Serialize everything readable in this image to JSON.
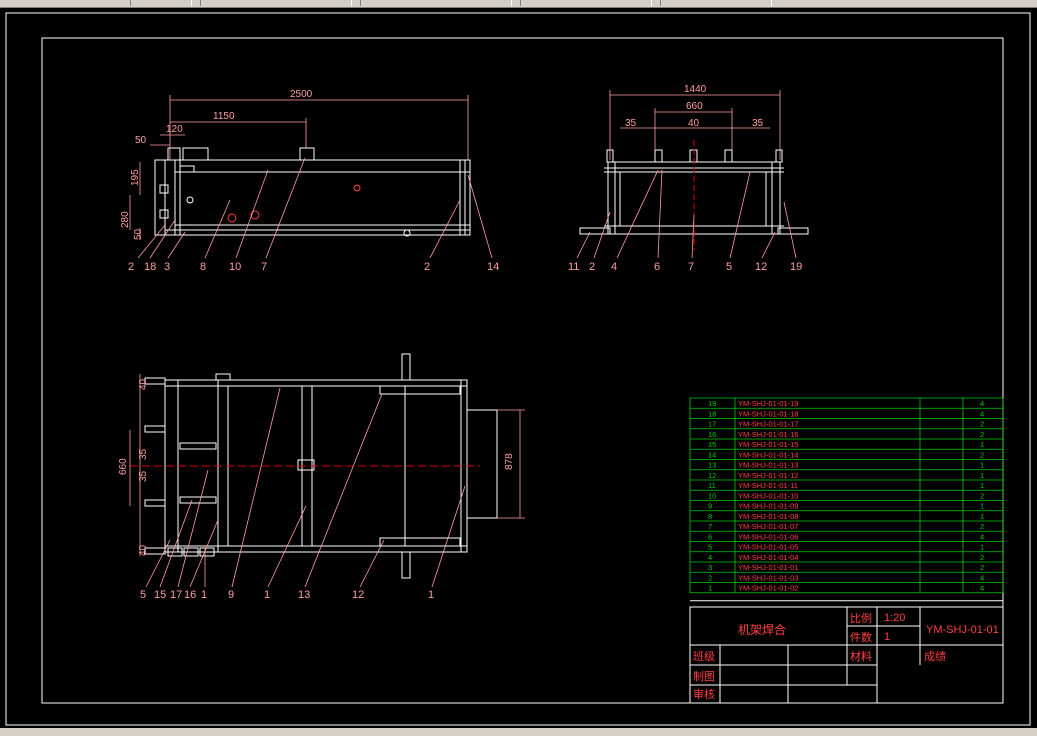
{
  "colors": {
    "background": "#000000",
    "geometry": "#ffffff",
    "dimension": "#ff9f9f",
    "table_grid": "#00cc00",
    "table_text": "#ff4040",
    "centerline": "#e00000"
  },
  "front_view": {
    "dims": [
      "2500",
      "1150",
      "120",
      "50",
      "195",
      "280",
      "50"
    ],
    "callouts": [
      "2",
      "18",
      "3",
      "8",
      "10",
      "7",
      "2",
      "14"
    ]
  },
  "side_view": {
    "dims": [
      "1440",
      "660",
      "35",
      "40",
      "35"
    ],
    "callouts": [
      "11",
      "2",
      "4",
      "6",
      "7",
      "5",
      "12",
      "19"
    ]
  },
  "top_view": {
    "dims": [
      "40",
      "35",
      "660",
      "35",
      "40",
      "878"
    ],
    "callouts": [
      "5",
      "15",
      "17",
      "16",
      "1",
      "9",
      "1",
      "13",
      "12",
      "1"
    ]
  },
  "parts_table": {
    "rows": [
      {
        "no": "19",
        "code": "YM-SHJ-01-01-19",
        "qty": "4"
      },
      {
        "no": "18",
        "code": "YM-SHJ-01-01-18",
        "qty": "4"
      },
      {
        "no": "17",
        "code": "YM-SHJ-01-01-17",
        "qty": "2"
      },
      {
        "no": "16",
        "code": "YM-SHJ-01-01-16",
        "qty": "2"
      },
      {
        "no": "15",
        "code": "YM-SHJ-01-01-15",
        "qty": "1"
      },
      {
        "no": "14",
        "code": "YM-SHJ-01-01-14",
        "qty": "2"
      },
      {
        "no": "13",
        "code": "YM-SHJ-01-01-13",
        "qty": "1"
      },
      {
        "no": "12",
        "code": "YM-SHJ-01-01-12",
        "qty": "1"
      },
      {
        "no": "11",
        "code": "YM-SHJ-01-01-11",
        "qty": "1"
      },
      {
        "no": "10",
        "code": "YM-SHJ-01-01-10",
        "qty": "2"
      },
      {
        "no": "9",
        "code": "YM-SHJ-01-01-09",
        "qty": "1"
      },
      {
        "no": "8",
        "code": "YM-SHJ-01-01-08",
        "qty": "1"
      },
      {
        "no": "7",
        "code": "YM-SHJ-01-01-07",
        "qty": "2"
      },
      {
        "no": "6",
        "code": "YM-SHJ-01-01-06",
        "qty": "4"
      },
      {
        "no": "5",
        "code": "YM-SHJ-01-01-05",
        "qty": "1"
      },
      {
        "no": "4",
        "code": "YM-SHJ-01-01-04",
        "qty": "2"
      },
      {
        "no": "3",
        "code": "YM-SHJ-01-01-01",
        "qty": "2"
      },
      {
        "no": "2",
        "code": "YM-SHJ-01-01-03",
        "qty": "4"
      },
      {
        "no": "1",
        "code": "YM-SHJ-01-01-02",
        "qty": "4"
      }
    ]
  },
  "title_block": {
    "drawing_title": "机架焊合",
    "scale_label": "比例",
    "scale_value": "1:20",
    "count_label": "件数",
    "count_value": "1",
    "drawing_no": "YM-SHJ-01-01",
    "class_label": "班级",
    "material_label": "材料",
    "grade_label": "成绩",
    "drafter_label": "制图",
    "checker_label": "审核"
  }
}
